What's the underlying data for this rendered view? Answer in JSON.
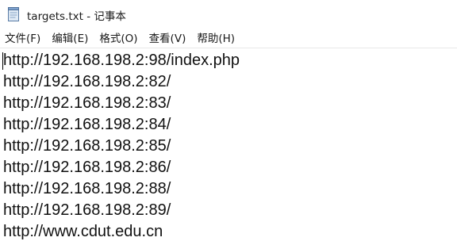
{
  "window": {
    "title": "targets.txt - 记事本"
  },
  "menu": {
    "items": [
      {
        "label": "文件(F)"
      },
      {
        "label": "编辑(E)"
      },
      {
        "label": "格式(O)"
      },
      {
        "label": "查看(V)"
      },
      {
        "label": "帮助(H)"
      }
    ]
  },
  "editor": {
    "lines": [
      "http://192.168.198.2:98/index.php",
      "http://192.168.198.2:82/",
      "http://192.168.198.2:83/",
      "http://192.168.198.2:84/",
      "http://192.168.198.2:85/",
      "http://192.168.198.2:86/",
      "http://192.168.198.2:88/",
      "http://192.168.198.2:89/",
      "http://www.cdut.edu.cn"
    ]
  },
  "icons": {
    "app": "notepad-icon"
  }
}
